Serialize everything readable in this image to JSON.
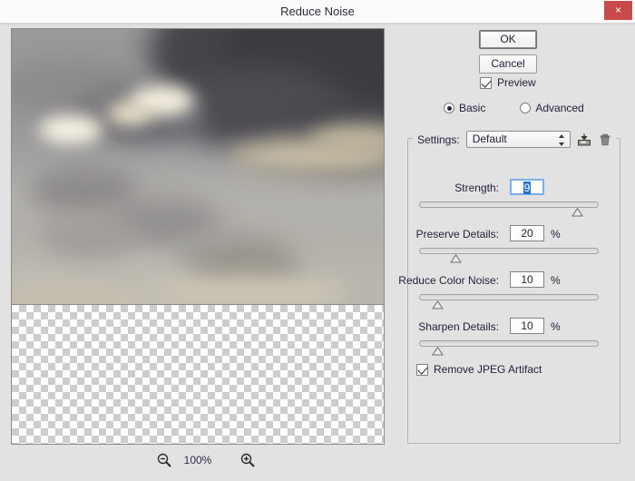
{
  "window": {
    "title": "Reduce Noise",
    "close_label": "×",
    "close_icon": "close-icon"
  },
  "preview": {
    "zoom_level": "100%",
    "zoom_out_icon": "magnifier-minus-icon",
    "zoom_in_icon": "magnifier-plus-icon",
    "image_alt": "stormy cloudscape preview",
    "transparency_alt": "transparent checkerboard area"
  },
  "buttons": {
    "ok": "OK",
    "cancel": "Cancel"
  },
  "options": {
    "preview_label": "Preview",
    "preview_checked": true,
    "mode_basic": "Basic",
    "mode_advanced": "Advanced",
    "mode_selected": "Basic"
  },
  "settings": {
    "label": "Settings:",
    "value": "Default",
    "save_icon": "save-preset-icon",
    "delete_icon": "trash-icon"
  },
  "sliders": [
    {
      "label": "Strength:",
      "value": "9",
      "unit": "",
      "percent": 88,
      "selected": true
    },
    {
      "label": "Preserve Details:",
      "value": "20",
      "unit": "%",
      "percent": 20,
      "selected": false
    },
    {
      "label": "Reduce Color Noise:",
      "value": "10",
      "unit": "%",
      "percent": 10,
      "selected": false
    },
    {
      "label": "Sharpen Details:",
      "value": "10",
      "unit": "%",
      "percent": 10,
      "selected": false
    }
  ],
  "jpeg": {
    "label": "Remove JPEG Artifact",
    "checked": true
  },
  "colors": {
    "dialog_bg": "#e2e2e2",
    "titlebar_bg": "#fbfbfb",
    "close_red": "#c84a4a",
    "selection_blue": "#2a6fd4",
    "text": "#22223a"
  }
}
